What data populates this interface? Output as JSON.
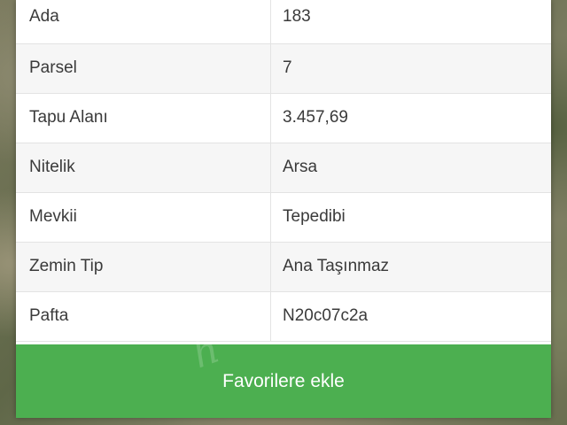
{
  "parcel_info": {
    "rows": [
      {
        "label": "Ada",
        "value": "183"
      },
      {
        "label": "Parsel",
        "value": "7"
      },
      {
        "label": "Tapu Alanı",
        "value": "3.457,69"
      },
      {
        "label": "Nitelik",
        "value": "Arsa"
      },
      {
        "label": "Mevkii",
        "value": "Tepedibi"
      },
      {
        "label": "Zemin Tip",
        "value": "Ana Taşınmaz"
      },
      {
        "label": "Pafta",
        "value": "N20c07c2a"
      }
    ]
  },
  "actions": {
    "add_favorites_label": "Favorilere ekle"
  },
  "colors": {
    "accent_green": "#4caf50"
  }
}
